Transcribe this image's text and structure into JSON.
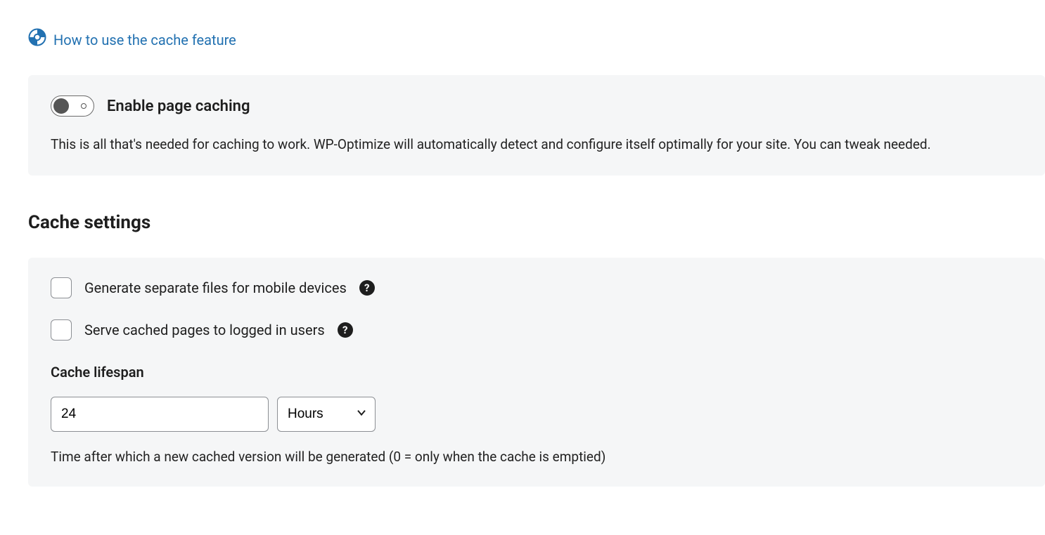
{
  "help_link": {
    "text": "How to use the cache feature"
  },
  "enable_panel": {
    "toggle_label": "Enable page caching",
    "toggle_on": false,
    "description": "This is all that's needed for caching to work. WP-Optimize will automatically detect and configure itself optimally for your site. You can tweak needed."
  },
  "settings": {
    "heading": "Cache settings",
    "mobile_label": "Generate separate files for mobile devices",
    "logged_in_label": "Serve cached pages to logged in users",
    "lifespan_label": "Cache lifespan",
    "lifespan_value": "24",
    "lifespan_unit": "Hours",
    "lifespan_hint": "Time after which a new cached version will be generated (0 = only when the cache is emptied)"
  }
}
